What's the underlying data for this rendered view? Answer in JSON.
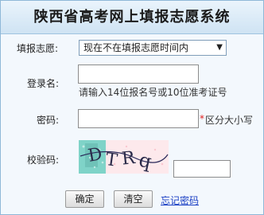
{
  "form": {
    "title": "陕西省高考网上填报志愿系统",
    "volunteer_label": "填报志愿:",
    "volunteer_value": "现在不在填报志愿时间内",
    "login_label": "登录名:",
    "login_value": "",
    "login_hint": "请输入14位报名号或10位准考证号",
    "password_label": "密码:",
    "password_value": "",
    "password_required_mark": "*",
    "password_hint": "区分大小写",
    "captcha_label": "校验码:",
    "captcha_value": "",
    "captcha_image_text": "DTRq",
    "confirm_label": "确定",
    "clear_label": "清空",
    "forgot_label": "忘记密码"
  }
}
